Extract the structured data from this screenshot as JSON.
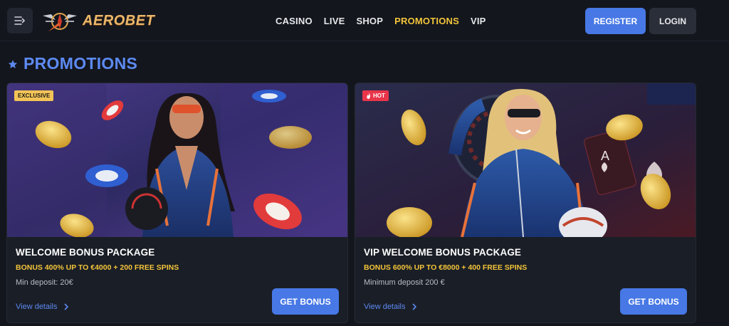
{
  "brand": {
    "name": "AEROBET"
  },
  "header": {
    "nav": [
      "CASINO",
      "LIVE",
      "SHOP",
      "PROMOTIONS",
      "VIP"
    ],
    "active_nav": "PROMOTIONS",
    "register_label": "REGISTER",
    "login_label": "LOGIN"
  },
  "page": {
    "title": "PROMOTIONS"
  },
  "promotions": [
    {
      "badge": "EXCLUSIVE",
      "title": "WELCOME BONUS PACKAGE",
      "subtitle": "BONUS 400% UP TO €4000 + 200 FREE SPINS",
      "min_deposit": "Min deposit: 20€",
      "details_label": "View details",
      "cta_label": "GET BONUS"
    },
    {
      "badge": "HOT",
      "title": "VIP WELCOME BONUS PACKAGE",
      "subtitle": "BONUS 600% UP TO €8000 + 400 FREE SPINS",
      "min_deposit": "Minimum deposit 200 €",
      "details_label": "View details",
      "cta_label": "GET BONUS"
    }
  ],
  "colors": {
    "accent": "#4778e5",
    "title_blue": "#5d8af2",
    "highlight_yellow": "#f3c43a",
    "hot_red": "#e8354a",
    "background": "#13161d"
  }
}
